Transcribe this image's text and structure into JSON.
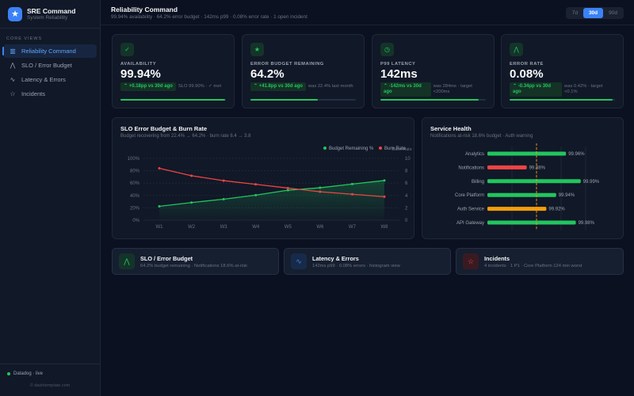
{
  "brand": {
    "title": "SRE Command",
    "subtitle": "System Reliability"
  },
  "sidebar": {
    "section": "CORE VIEWS",
    "items": [
      {
        "label": "Reliability Command",
        "icon": "bar-chart-icon",
        "active": true
      },
      {
        "label": "SLO / Error Budget",
        "icon": "trend-icon"
      },
      {
        "label": "Latency & Errors",
        "icon": "pulse-icon"
      },
      {
        "label": "Incidents",
        "icon": "star-icon"
      }
    ],
    "status": "Datadog · live",
    "copyright": "© dashtemplate.com"
  },
  "header": {
    "title": "Reliability Command",
    "subtitle": "99.94% availability · 64.2% error budget · 142ms p99 · 0.08% error rate · 1 open incident",
    "ranges": [
      "7d",
      "30d",
      "90d"
    ],
    "selected_range": "30d"
  },
  "kpis": [
    {
      "label": "AVAILABILITY",
      "value": "99.94%",
      "delta": "+0.18pp vs 30d ago",
      "note": "SLO 99.90% · ✓ met",
      "progress": 99,
      "icon": "check-icon"
    },
    {
      "label": "ERROR BUDGET REMAINING",
      "value": "64.2%",
      "delta": "+41.8pp vs 30d ago",
      "note": "was 22.4% last month",
      "progress": 64.2,
      "icon": "star-icon"
    },
    {
      "label": "P99 LATENCY",
      "value": "142ms",
      "delta": "-142ms vs 30d ago",
      "note": "was 284ms · target <200ms",
      "progress": 93,
      "icon": "clock-icon"
    },
    {
      "label": "ERROR RATE",
      "value": "0.08%",
      "delta": "-0.34pp vs 30d ago",
      "note": "was 0.42% · target <0.1%",
      "progress": 98,
      "icon": "trend-icon"
    }
  ],
  "colors": {
    "green": "#22c55e",
    "red": "#ef4444",
    "amber": "#f59e0b",
    "blue": "#3b82f6"
  },
  "chart_data": [
    {
      "type": "line",
      "title": "SLO Error Budget & Burn Rate",
      "subtitle": "Budget recovering from 22.4% → 64.2% · burn rate 8.4 → 3.8",
      "categories": [
        "W1",
        "W2",
        "W3",
        "W4",
        "W5",
        "W6",
        "W7",
        "W8"
      ],
      "y_ticks": [
        "0%",
        "20%",
        "40%",
        "60%",
        "80%",
        "100%"
      ],
      "ylim": [
        0,
        100
      ],
      "y2_ticks": [
        "0",
        "2",
        "4",
        "6",
        "8",
        "10"
      ],
      "y2lim": [
        0,
        10
      ],
      "y2label": "Burn Rate",
      "legend_position": "top-right",
      "grid": true,
      "series": [
        {
          "name": "Budget Remaining %",
          "axis": "left",
          "color": "#22c55e",
          "values": [
            22.4,
            28.5,
            34,
            40.5,
            48.5,
            52.5,
            58.5,
            64.2
          ]
        },
        {
          "name": "Burn Rate",
          "axis": "right",
          "color": "#ef4444",
          "values": [
            8.4,
            7.2,
            6.4,
            5.8,
            5.2,
            4.6,
            4.2,
            3.8
          ]
        }
      ]
    },
    {
      "type": "bar",
      "orientation": "horizontal",
      "title": "Service Health",
      "subtitle": "Notifications at-risk 18.6% budget · Auth warning",
      "xlim": [
        99.8,
        100.0
      ],
      "target": 99.9,
      "categories": [
        "Analytics",
        "Notifications",
        "Billing",
        "Core Platform",
        "Auth Service",
        "API Gateway"
      ],
      "values": [
        99.96,
        99.88,
        99.99,
        99.94,
        99.92,
        99.98
      ],
      "labels": [
        "99.96%",
        "99.88%",
        "99.99%",
        "99.94%",
        "99.92%",
        "99.98%"
      ],
      "colors": [
        "#22c55e",
        "#ef4444",
        "#22c55e",
        "#22c55e",
        "#f59e0b",
        "#22c55e"
      ]
    }
  ],
  "quicklinks": [
    {
      "title": "SLO / Error Budget",
      "subtitle": "64.2% budget remaining · Notifications 18.6% at-risk",
      "icon": "trend-icon"
    },
    {
      "title": "Latency & Errors",
      "subtitle": "142ms p99 · 0.08% errors · histogram view",
      "icon": "pulse-icon"
    },
    {
      "title": "Incidents",
      "subtitle": "4 incidents · 1 P1 · Core Platform 124 min worst",
      "icon": "star-icon"
    }
  ]
}
